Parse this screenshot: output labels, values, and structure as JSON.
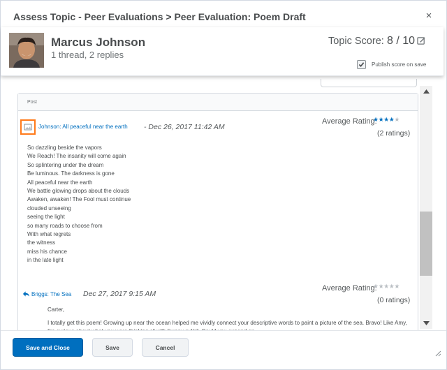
{
  "dialog": {
    "title": "Assess Topic - Peer Evaluations > Peer Evaluation: Poem Draft",
    "close_icon": "close-icon"
  },
  "user": {
    "name": "Marcus Johnson",
    "summary": "1 thread, 2 replies",
    "avatar_icon": "user-avatar-photo"
  },
  "score": {
    "label": "Topic Score:",
    "value": "8 / 10",
    "edit_icon": "edit-icon",
    "publish_label": "Publish score on save",
    "publish_checked": true
  },
  "thread": {
    "header": "Post",
    "post": {
      "title": "Johnson: All peaceful near the earth",
      "date": "- Dec 26, 2017 11:42 AM",
      "rating_label": "Average Rating:",
      "rating_value": 4,
      "rating_max": 5,
      "rating_count": "(2 ratings)",
      "lines": [
        "So dazzling beside the vapors",
        "We Reach! The insanity will come again",
        "So splintering under the dream",
        "Be luminous. The darkness is gone",
        "All peaceful near the earth",
        "We battle glowing drops about the clouds",
        "Awaken, awaken! The Fool must continue",
        "clouded unseeing",
        "seeing the light",
        "so many roads to choose from",
        "With what regrets",
        "the witness",
        "miss his chance",
        "in the late light"
      ]
    },
    "reply": {
      "title": "Briggs: The Sea",
      "date": "Dec 27, 2017 9:15 AM",
      "rating_label": "Average Rating:",
      "rating_value": 0,
      "rating_max": 5,
      "rating_count": "(0 ratings)",
      "greeting": "Carter,",
      "body": "I totally get this poem! Growing up near the ocean helped me vividly connect your descriptive words to paint a picture of the sea. Bravo! Like Amy, I'm curious about what you were thinking of with \"runny gulls\". Could you expand on"
    }
  },
  "footer": {
    "save_close_label": "Save and Close",
    "save_label": "Save",
    "cancel_label": "Cancel"
  },
  "colors": {
    "primary": "#006fbf",
    "highlight": "#ff7a1a"
  }
}
